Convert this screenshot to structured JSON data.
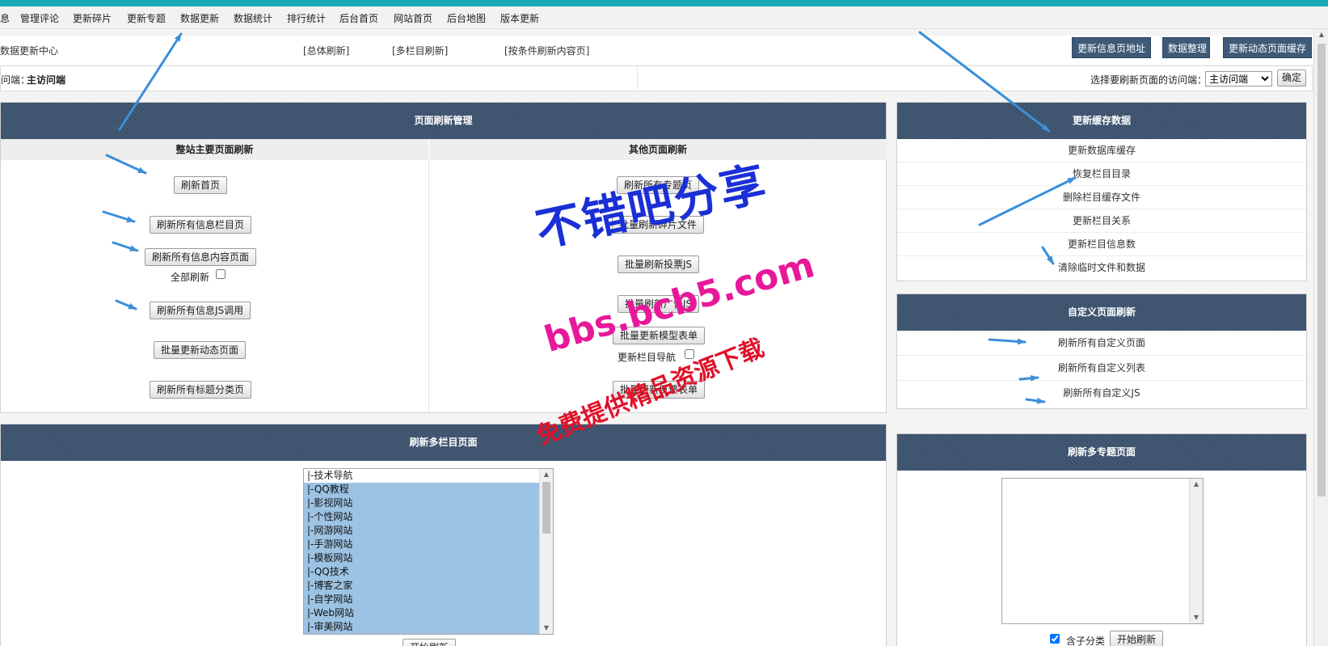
{
  "menu": [
    "息",
    "管理评论",
    "更新碎片",
    "更新专题",
    "数据更新",
    "数据统计",
    "排行统计",
    "后台首页",
    "网站首页",
    "后台地图",
    "版本更新"
  ],
  "sub1": {
    "title": "数据更新中心",
    "link_all": "[总体刷新]",
    "link_multi": "[多栏目刷新]",
    "link_cond": "[按条件刷新内容页]",
    "btn_info_url": "更新信息页地址",
    "btn_data": "数据整理",
    "btn_dynamic": "更新动态页面缓存"
  },
  "sub2": {
    "client_label": "问端：",
    "client_value": "主访问端",
    "select_label": "选择要刷新页面的访问端：",
    "select_value": "主访问端",
    "ok": "确定"
  },
  "page_refresh": {
    "title": "页面刷新管理",
    "left_head": "整站主要页面刷新",
    "right_head": "其他页面刷新",
    "left_buttons": [
      "刷新首页",
      "刷新所有信息栏目页",
      "刷新所有信息内容页面",
      "刷新所有信息JS调用",
      "批量更新动态页面",
      "刷新所有标题分类页"
    ],
    "full_refresh": "全部刷新",
    "right_buttons": [
      "刷新所有专题页",
      "批量刷新碎片文件",
      "批量刷新投票JS",
      "批量刷新广告JS",
      "批量更新模型表单",
      "批量更新反馈表单"
    ],
    "update_nav": "更新栏目导航"
  },
  "cache": {
    "title": "更新缓存数据",
    "items": [
      "更新数据库缓存",
      "恢复栏目目录",
      "删除栏目缓存文件",
      "更新栏目关系",
      "更新栏目信息数",
      "清除临时文件和数据"
    ]
  },
  "custom": {
    "title": "自定义页面刷新",
    "items": [
      "刷新所有自定义页面",
      "刷新所有自定义列表",
      "刷新所有自定义JS"
    ]
  },
  "multi_col": {
    "title": "刷新多栏目页面",
    "options": [
      "|-技术导航",
      "|-QQ教程",
      "|-影视网站",
      "|-个性网站",
      "|-网游网站",
      "|-手游网站",
      "|-模板网站",
      "|-QQ技术",
      "|-博客之家",
      "|-自学网站",
      "|-Web网站",
      "|-审美网站"
    ],
    "start": "开始刷新"
  },
  "multi_topic": {
    "title": "刷新多专题页面",
    "include_sub": "含子分类",
    "start": "开始刷新"
  },
  "watermark": {
    "line1": "不错吧分享",
    "line2": "bbs.bcb5.com",
    "line3": "免费提供精品资源下载"
  },
  "colors": {
    "accent_top": "#19a9b7",
    "panel_header": "#3d5470",
    "dark_button": "#3e5a77",
    "selection": "#9cc3e3",
    "arrow": "#3b8fd9",
    "wm_blue": "#1a2fd6",
    "wm_pink": "#e8189a",
    "wm_red": "#e0112a"
  }
}
